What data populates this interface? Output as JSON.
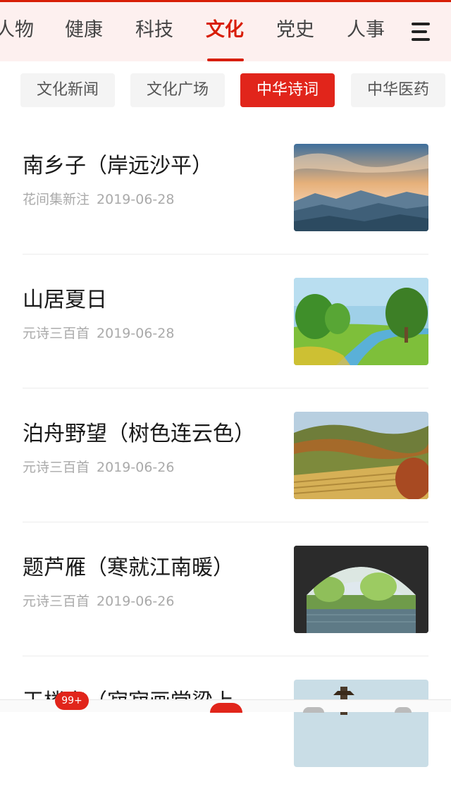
{
  "top_tabs": [
    {
      "label": "人物"
    },
    {
      "label": "健康"
    },
    {
      "label": "科技"
    },
    {
      "label": "文化"
    },
    {
      "label": "党史"
    },
    {
      "label": "人事"
    }
  ],
  "active_tab": "文化",
  "sub_tabs": [
    {
      "label": "文化新闻"
    },
    {
      "label": "文化广场"
    },
    {
      "label": "中华诗词"
    },
    {
      "label": "中华医药"
    }
  ],
  "active_sub_tab": "中华诗词",
  "articles": [
    {
      "title": "南乡子（岸远沙平）",
      "source": "花间集新注",
      "date": "2019-06-28",
      "thumb": "mountains-sunset"
    },
    {
      "title": "山居夏日",
      "source": "元诗三百首",
      "date": "2019-06-28",
      "thumb": "river-painting"
    },
    {
      "title": "泊舟野望（树色连云色）",
      "source": "元诗三百首",
      "date": "2019-06-26",
      "thumb": "autumn-hills"
    },
    {
      "title": "题芦雁（寒就江南暖）",
      "source": "元诗三百首",
      "date": "2019-06-26",
      "thumb": "bridge-lake"
    },
    {
      "title": "玉楼春（寂寂画堂梁上",
      "source": "",
      "date": "",
      "thumb": "pagoda"
    }
  ],
  "bottom_bar": {
    "badge": "99+"
  },
  "colors": {
    "accent": "#d81e06",
    "chip_active": "#e1251b",
    "meta": "#aaaaaa",
    "nav_bg": "#fdf0ef"
  }
}
